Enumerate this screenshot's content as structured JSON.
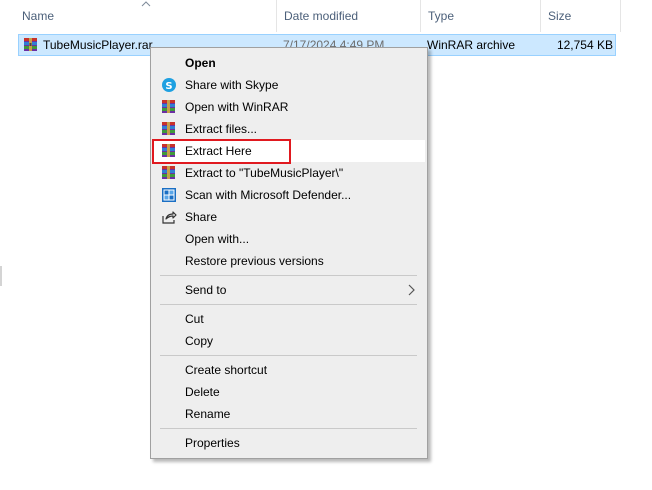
{
  "columns": {
    "name": "Name",
    "date_modified": "Date modified",
    "type": "Type",
    "size": "Size"
  },
  "file": {
    "name": "TubeMusicPlayer.rar",
    "date_modified": "7/17/2024 4:49 PM",
    "type": "WinRAR archive",
    "size": "12,754 KB",
    "icon": "winrar-archive-icon"
  },
  "context_menu": {
    "items": {
      "open": "Open",
      "share_skype": "Share with Skype",
      "open_winrar": "Open with WinRAR",
      "extract_files": "Extract files...",
      "extract_here": "Extract Here",
      "extract_to": "Extract to \"TubeMusicPlayer\\\"",
      "scan_defender": "Scan with Microsoft Defender...",
      "share": "Share",
      "open_with": "Open with...",
      "restore": "Restore previous versions",
      "send_to": "Send to",
      "cut": "Cut",
      "copy": "Copy",
      "create_shortcut": "Create shortcut",
      "delete": "Delete",
      "rename": "Rename",
      "properties": "Properties"
    },
    "hovered_item": "Extract Here",
    "annotation_color": "#e0191f"
  },
  "colors": {
    "selection_bg": "#cce8ff",
    "selection_border": "#99d1ff",
    "menu_bg": "#eeeeee",
    "header_text": "#4c607a"
  }
}
